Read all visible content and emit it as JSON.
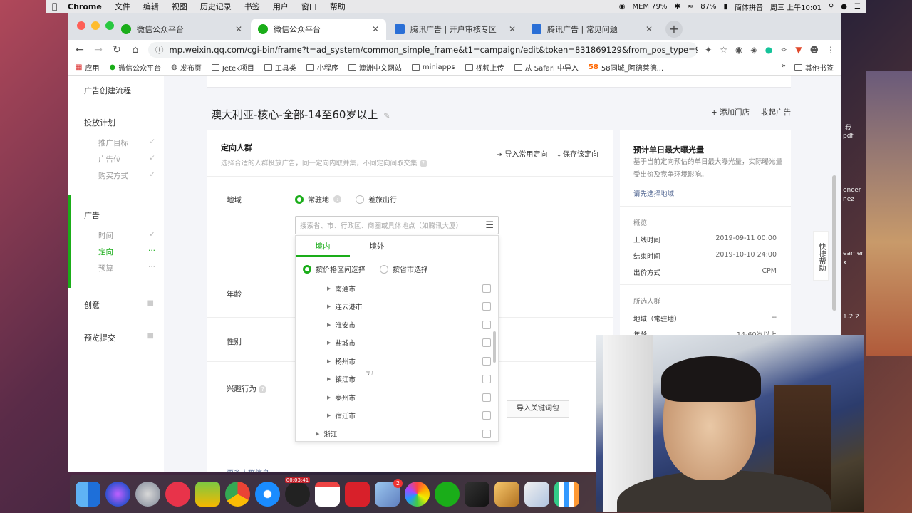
{
  "menubar": {
    "app": "Chrome",
    "menus": [
      "文件",
      "编辑",
      "视图",
      "历史记录",
      "书签",
      "用户",
      "窗口",
      "帮助"
    ],
    "mem": "MEM 79%",
    "battery": "87%",
    "ime": "简体拼音",
    "clock": "周三 上午10:01"
  },
  "tabs": [
    {
      "title": "微信公众平台",
      "active": false
    },
    {
      "title": "微信公众平台",
      "active": true
    },
    {
      "title": "腾讯广告 | 开户审核专区",
      "active": false
    },
    {
      "title": "腾讯广告 | 常见问题",
      "active": false
    }
  ],
  "url": "mp.weixin.qq.com/cgi-bin/frame?t=ad_system/common_simple_frame&t1=campaign/edit&token=831869129&from_pos_type=9...",
  "bookmarks": [
    "应用",
    "微信公众平台",
    "发布页",
    "Jetek项目",
    "工具类",
    "小程序",
    "澳洲中文网站",
    "miniapps",
    "视频上传",
    "从 Safari 中导入",
    "58同城_阿德莱德..."
  ],
  "bookmarks_other": "其他书签",
  "sidebar": {
    "title": "广告创建流程",
    "plan": "投放计划",
    "plan_items": [
      "推广目标",
      "广告位",
      "购买方式"
    ],
    "ad": "广告",
    "ad_items": [
      "时间",
      "定向",
      "预算"
    ],
    "creative": "创意",
    "preview": "预览提交"
  },
  "page": {
    "title": "澳大利亚-核心-全部-14至60岁以上",
    "add_store": "添加门店",
    "collapse": "收起广告"
  },
  "targeting": {
    "title": "定向人群",
    "desc": "选择合适的人群投放广告，同一定向内取并集，不同定向间取交集",
    "import": "导入常用定向",
    "save": "保存该定向",
    "region_label": "地域",
    "resident": "常驻地",
    "travel": "差旅出行",
    "search_placeholder": "搜索省、市、行政区、商圈或具体地点（如腾讯大厦）",
    "tab_domestic": "境内",
    "tab_overseas": "境外",
    "mode_price": "按价格区间选择",
    "mode_city": "按省市选择",
    "cities": [
      "南通市",
      "连云港市",
      "淮安市",
      "盐城市",
      "扬州市",
      "镇江市",
      "泰州市",
      "宿迁市"
    ],
    "province": "浙江",
    "age_label": "年龄",
    "gender_label": "性别",
    "interest_label": "兴趣行为",
    "keyword_btn": "导入关键词包",
    "bottom_link": "更多人群信息"
  },
  "estimate": {
    "title": "预计单日最大曝光量",
    "desc": "基于当前定向预估的单日最大曝光量，实际曝光量受出价及竞争环境影响。",
    "hint": "请先选择地域",
    "overview": "概览",
    "rows": [
      {
        "k": "上线时间",
        "v": "2019-09-11 00:00"
      },
      {
        "k": "结束时间",
        "v": "2019-10-10 24:00"
      },
      {
        "k": "出价方式",
        "v": "CPM"
      }
    ],
    "selected": "所选人群",
    "sel_rows": [
      {
        "k": "地域（常驻地）",
        "v": "--"
      },
      {
        "k": "年龄",
        "v": "14-60岁以上"
      }
    ]
  },
  "help": "快捷帮助",
  "dock": {
    "badge": "2",
    "recorder": "00:03:41"
  },
  "desktop_labels": [
    "我",
    "pdf",
    "encer",
    "nez",
    "eamer",
    "x",
    "1.2.2"
  ]
}
